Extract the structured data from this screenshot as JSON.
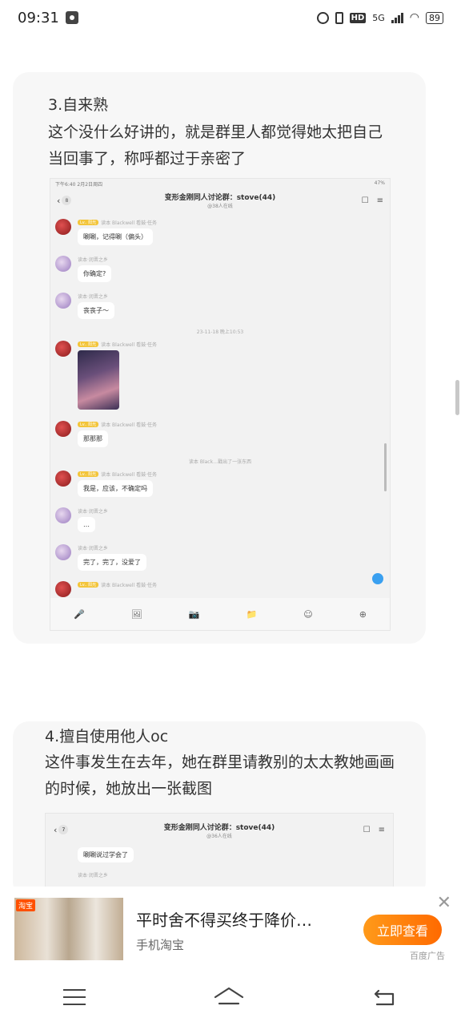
{
  "status_bar": {
    "time": "09:31",
    "network": "5G",
    "battery": "89"
  },
  "card1": {
    "title": "3.自来熟",
    "body": "这个没什么好讲的，就是群里人都觉得她太把自己当回事了，称呼都过于亲密了",
    "screenshot": {
      "status_time": "下午6:40  2月2日周四",
      "status_battery": "47%",
      "back_count": "8",
      "group_title": "变形金刚同人讨论群：stove(44)",
      "group_sub": "@38人在线",
      "messages": [
        {
          "meta": "读本 Blackwell 看鼓·任务",
          "tag": "Lv.. 阳光",
          "text": "唰唰，记得唰（偏头）",
          "avatar": "red"
        },
        {
          "meta": "读本·润晋之乡",
          "text": "你确定?",
          "avatar": "purple"
        },
        {
          "meta": "读本·润晋之乡",
          "text": "丧丧子～",
          "avatar": "purple"
        },
        {
          "meta": "读本 Blackwell 看鼓·任务",
          "tag": "Lv.. 阳光",
          "image": true,
          "avatar": "red"
        },
        {
          "meta": "读本 Blackwell 看鼓·任务",
          "tag": "Lv.. 阳光",
          "text": "那那那",
          "avatar": "red"
        },
        {
          "meta": "读本 Blackwell 看鼓·任务",
          "tag": "Lv.. 阳光",
          "text": "我是，应该，不确定吗",
          "avatar": "red"
        },
        {
          "meta": "读本·润晋之乡",
          "text": "…",
          "avatar": "purple"
        },
        {
          "meta": "读本·润晋之乡",
          "text": "完了，完了，没爱了",
          "avatar": "purple"
        },
        {
          "meta": "读本 Blackwell 看鼓·任务",
          "tag": "Lv.. 阳光",
          "avatar": "red"
        }
      ],
      "sys_time": "23-11-18 晚上10:53",
      "sys_notice": "读本 Black…戳出了一张东西",
      "toolbar": [
        "🎤",
        "🖼",
        "📷",
        "📁",
        "☺",
        "⊕"
      ]
    }
  },
  "card2": {
    "title": "4.擅自使用他人oc",
    "body": "这件事发生在去年，她在群里请教别的太太教她画画的时候，她放出一张截图",
    "screenshot": {
      "back_count": "7",
      "group_title": "变形金刚同人讨论群：stove(44)",
      "group_sub": "@36人在线",
      "message": "唰唰说过学会了",
      "meta": "读本·润晋之乡"
    }
  },
  "ad": {
    "brand": "淘宝",
    "title": "平时舍不得买终于降价…",
    "source": "手机淘宝",
    "button": "立即查看",
    "label": "百度广告",
    "close": "✕"
  }
}
